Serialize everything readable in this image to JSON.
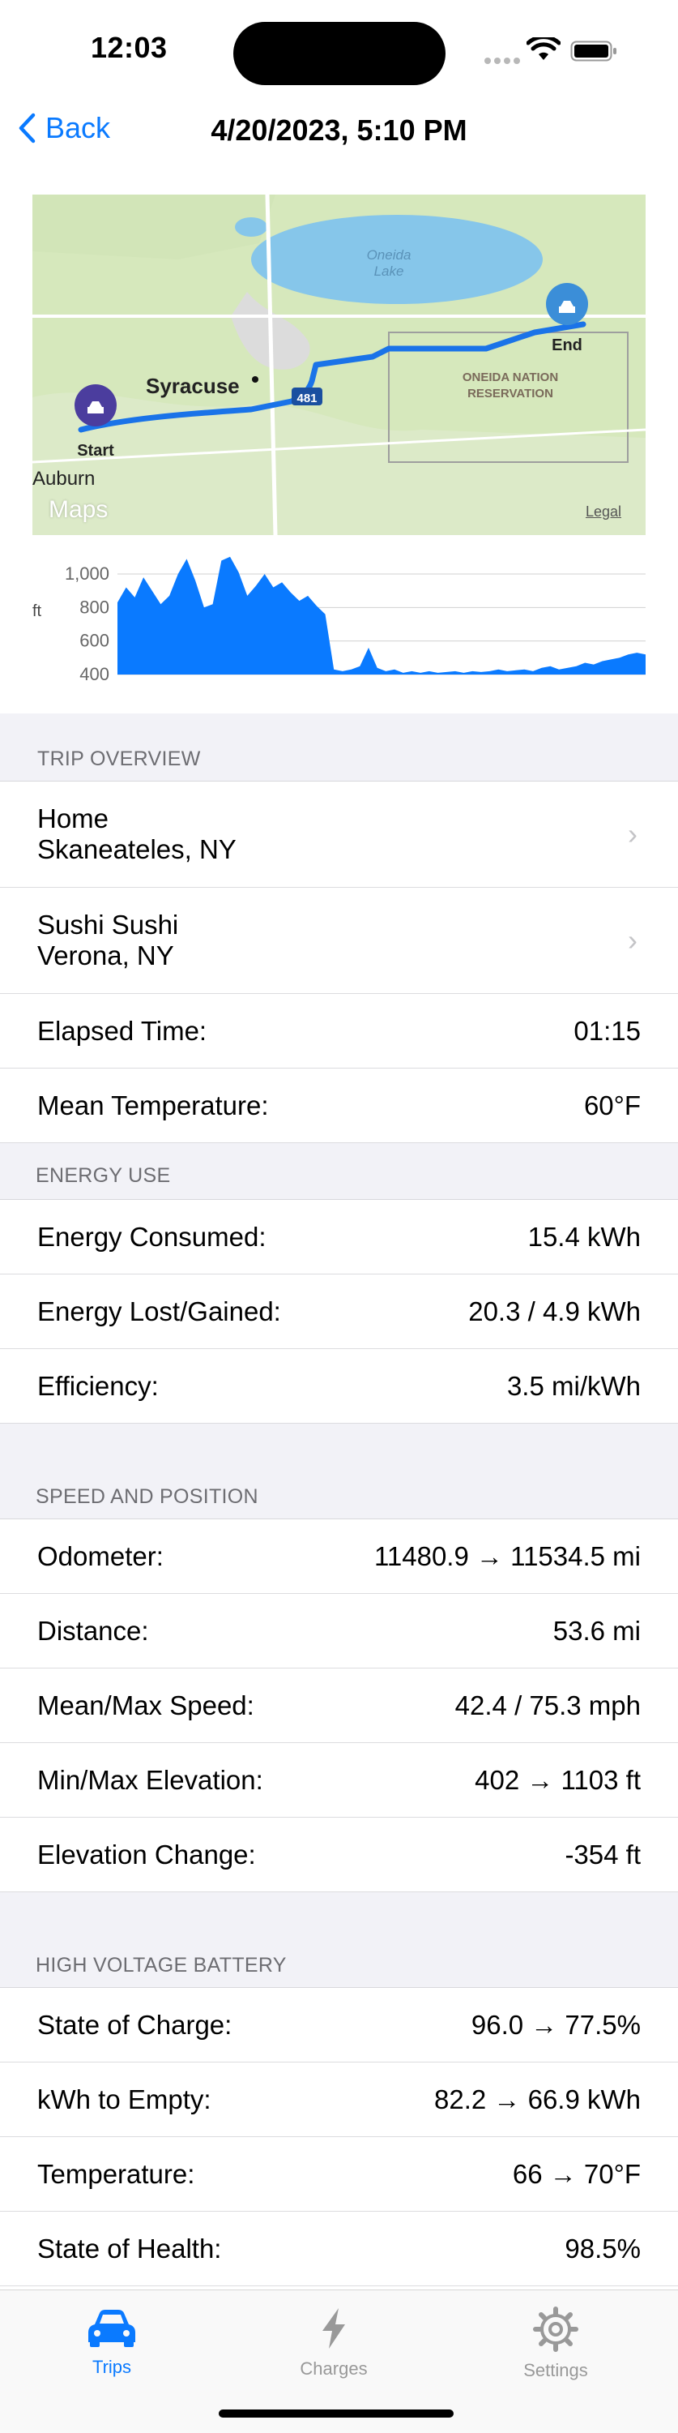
{
  "status_bar": {
    "time": "12:03"
  },
  "nav": {
    "back_label": "Back",
    "title": "4/20/2023, 5:10 PM"
  },
  "map": {
    "labels": {
      "lake": "Oneida\nLake",
      "city": "Syracuse",
      "auburn": "Auburn",
      "reservation": "ONEIDA NATION\nRESERVATION",
      "highway": "481"
    },
    "start_label": "Start",
    "end_label": "End",
    "logo": "Maps",
    "legal": "Legal"
  },
  "elevation": {
    "unit": "ft",
    "yticks": [
      "1,000",
      "800",
      "600",
      "400"
    ]
  },
  "chart_data": {
    "type": "area",
    "ylabel": "ft",
    "ylim": [
      400,
      1103
    ],
    "yticks": [
      1000,
      800,
      600,
      400
    ],
    "values": [
      830,
      920,
      860,
      980,
      900,
      820,
      870,
      1000,
      1090,
      960,
      800,
      820,
      1080,
      1103,
      1010,
      870,
      930,
      1000,
      920,
      950,
      890,
      840,
      870,
      810,
      760,
      430,
      420,
      430,
      450,
      560,
      440,
      420,
      430,
      410,
      420,
      410,
      420,
      410,
      415,
      420,
      410,
      420,
      415,
      420,
      430,
      420,
      425,
      430,
      420,
      440,
      450,
      430,
      440,
      450,
      470,
      460,
      480,
      490,
      500,
      520,
      530,
      520
    ]
  },
  "sections": {
    "trip_overview": {
      "header": "TRIP OVERVIEW",
      "origin": "Home\nSkaneateles, NY",
      "destination": "Sushi Sushi\nVerona, NY",
      "elapsed_label": "Elapsed Time:",
      "elapsed_value": "01:15",
      "temp_label": "Mean Temperature:",
      "temp_value": "60°F"
    },
    "energy_use": {
      "header": "ENERGY USE",
      "consumed_label": "Energy Consumed:",
      "consumed_value": "15.4 kWh",
      "lost_label": "Energy Lost/Gained:",
      "lost_value": "20.3  /  4.9 kWh",
      "eff_label": "Efficiency:",
      "eff_value": "3.5 mi/kWh"
    },
    "speed_position": {
      "header": "SPEED AND POSITION",
      "odo_label": "Odometer:",
      "odo_value": "11480.9  →  11534.5 mi",
      "dist_label": "Distance:",
      "dist_value": "53.6 mi",
      "speed_label": "Mean/Max Speed:",
      "speed_value": "42.4  /  75.3 mph",
      "elev_label": "Min/Max Elevation:",
      "elev_value": "402  →  1103 ft",
      "elevchg_label": "Elevation Change:",
      "elevchg_value": "-354 ft"
    },
    "hv_battery": {
      "header": "HIGH VOLTAGE BATTERY",
      "soc_label": "State of Charge:",
      "soc_value": "96.0  →  77.5%",
      "kwh_label": "kWh to Empty:",
      "kwh_value": "82.2  →  66.9 kWh",
      "temp_label": "Temperature:",
      "temp_value": "66  →  70°F",
      "soh_label": "State of Health:",
      "soh_value": "98.5%"
    }
  },
  "tabs": [
    {
      "label": "Trips",
      "icon": "car-icon"
    },
    {
      "label": "Charges",
      "icon": "bolt-icon"
    },
    {
      "label": "Settings",
      "icon": "gear-icon"
    }
  ],
  "colors": {
    "accent": "#0a7aff",
    "route": "#1a73e8",
    "chart_fill": "#0a7aff"
  }
}
